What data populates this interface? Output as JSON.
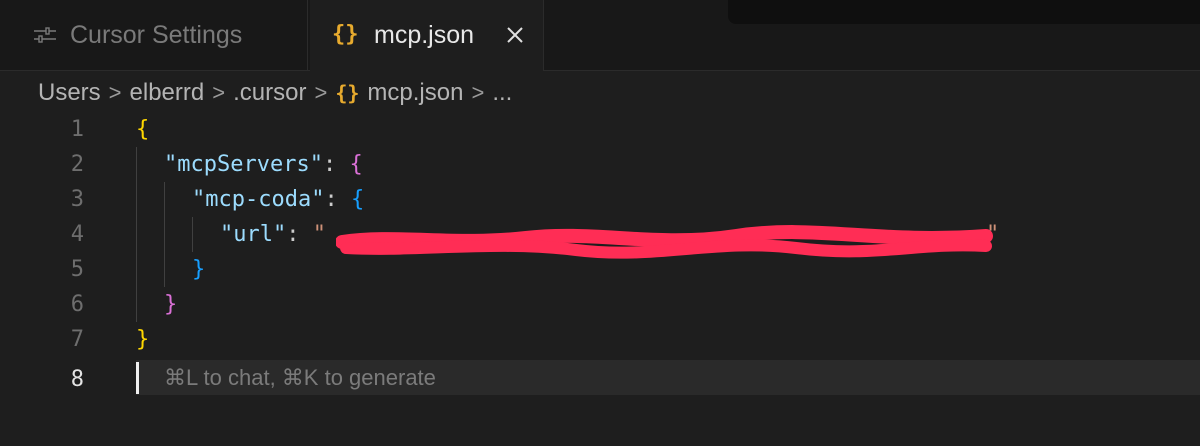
{
  "tabs": [
    {
      "label": "Cursor Settings",
      "icon": "settings-sliders-icon",
      "active": false
    },
    {
      "label": "mcp.json",
      "icon": "json-braces-icon",
      "active": true
    }
  ],
  "breadcrumb": {
    "items": [
      "Users",
      "elberrd",
      ".cursor",
      "mcp.json",
      "..."
    ],
    "separator": ">"
  },
  "editor": {
    "line_numbers": [
      "1",
      "2",
      "3",
      "4",
      "5",
      "6",
      "7",
      "8"
    ],
    "active_line": "8",
    "tokens": {
      "l1_open": "{",
      "l2_key": "\"mcpServers\"",
      "l2_colon": ": ",
      "l2_open": "{",
      "l3_key": "\"mcp-coda\"",
      "l3_colon": ": ",
      "l3_open": "{",
      "l4_key": "\"url\"",
      "l4_colon": ": ",
      "l4_quote_open": "\"",
      "l4_quote_close": "\"",
      "l5_close": "}",
      "l6_close": "}",
      "l7_close": "}"
    },
    "url_value_redacted": true,
    "placeholder_hint": "⌘L to chat, ⌘K to generate"
  },
  "colors": {
    "background": "#1e1e1e",
    "tab_bar": "#181818",
    "json_icon": "#e8ab2e",
    "key": "#9cdcfe",
    "bracket_level1": "#ffd700",
    "bracket_level2": "#da70d6",
    "bracket_level3": "#179fff",
    "redaction": "#ff2d55"
  }
}
